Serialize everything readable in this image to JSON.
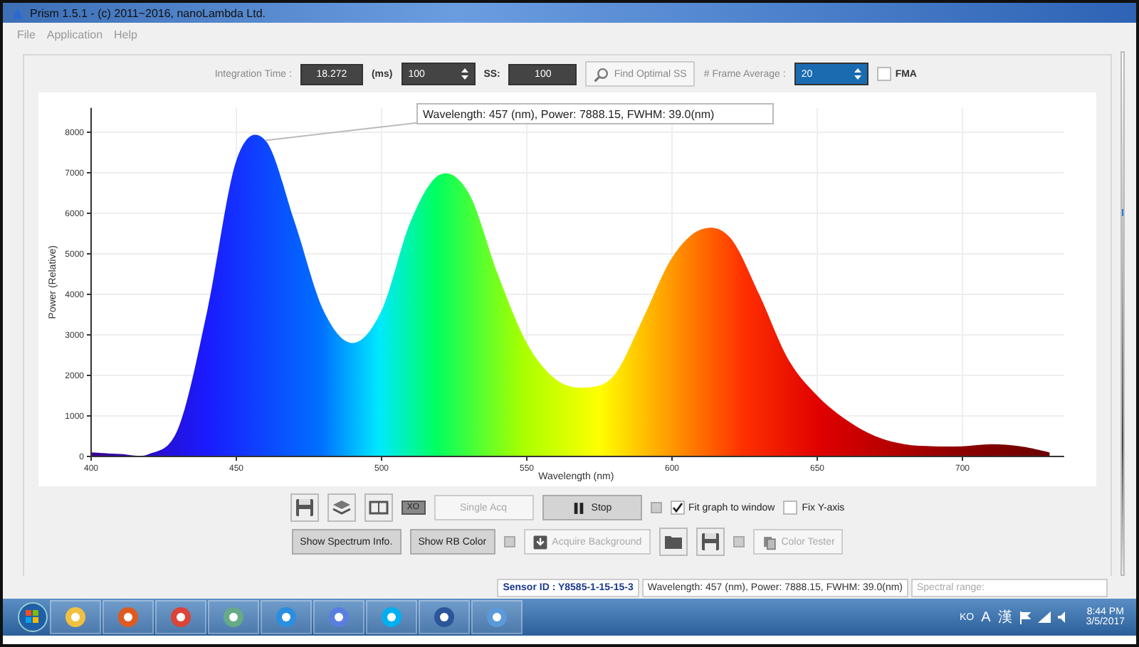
{
  "window": {
    "title": "Prism 1.5.1 - (c) 2011~2016, nanoLambda Ltd."
  },
  "menu": [
    "File",
    "Application",
    "Help"
  ],
  "acquisition": {
    "integration_label": "Integration Time :",
    "integration_value": "18.272",
    "unit": "(ms)",
    "unit_spin": "100",
    "ss_label": "SS:",
    "ss_value": "100",
    "find_button": "Find Optimal SS",
    "frame_label": "# Frame Average :",
    "frame_value": "20",
    "fma": {
      "label": "FMA",
      "checked": false
    }
  },
  "chart": {
    "peak_info": "Wavelength: 457 (nm), Power: 7888.15, FWHM: 39.0(nm)",
    "chart_data": {
      "type": "area",
      "xlabel": "Wavelength (nm)",
      "ylabel": "Power (Relative)",
      "x": [
        400,
        410,
        420,
        430,
        440,
        450,
        460,
        470,
        480,
        490,
        500,
        510,
        520,
        530,
        540,
        550,
        560,
        570,
        580,
        590,
        600,
        610,
        620,
        630,
        640,
        650,
        660,
        670,
        680,
        690,
        700,
        710,
        720,
        730
      ],
      "values": [
        100,
        60,
        60,
        700,
        3600,
        7300,
        7800,
        5800,
        3600,
        2800,
        3600,
        5800,
        6950,
        6500,
        4500,
        2800,
        1900,
        1700,
        2000,
        3400,
        4900,
        5600,
        5400,
        4000,
        2400,
        1500,
        900,
        500,
        300,
        250,
        250,
        300,
        250,
        100
      ],
      "grid": true,
      "xlim": [
        400,
        735
      ],
      "ylim": [
        0,
        8600
      ],
      "xticks": [
        400,
        450,
        500,
        550,
        600,
        650,
        700
      ],
      "yticks": [
        0,
        1000,
        2000,
        3000,
        4000,
        5000,
        6000,
        7000,
        8000
      ]
    }
  },
  "controls": [
    [
      {
        "kind": "icon_button"
      },
      {
        "kind": "icon_button"
      },
      {
        "kind": "icon_button"
      },
      {
        "kind": "tag",
        "label": "XO"
      },
      {
        "kind": "text_button",
        "label": "Single Acq",
        "pressed": false,
        "disabled": true
      },
      {
        "kind": "text_button",
        "label": "Stop",
        "pressed": true,
        "disabled": false
      },
      {
        "kind": "indicator"
      },
      {
        "kind": "checkbox",
        "label": "Fit graph to window",
        "checked": true
      },
      {
        "kind": "checkbox",
        "label": "Fix Y-axis",
        "checked": false
      }
    ],
    [
      {
        "kind": "text_button",
        "label": "Show Spectrum Info.",
        "pressed": true,
        "disabled": false
      },
      {
        "kind": "text_button",
        "label": "Show RB Color",
        "pressed": true,
        "disabled": false
      },
      {
        "kind": "indicator"
      },
      {
        "kind": "text_button",
        "label": "Acquire Background",
        "pressed": false,
        "disabled": true
      },
      {
        "kind": "icon_button"
      },
      {
        "kind": "icon_button"
      },
      {
        "kind": "indicator"
      },
      {
        "kind": "text_button",
        "label": "Color Tester",
        "pressed": false,
        "disabled": true
      }
    ]
  ],
  "status_bar": {
    "sensor": "Sensor ID : Y8585-1-15-15-3",
    "reading": "Wavelength: 457 (nm), Power: 7888.15, FWHM: 39.0(nm)",
    "range": "Spectral range:"
  },
  "taskbar": {
    "tray": [
      "KO",
      "A",
      "漢"
    ],
    "time": "8:44 PM",
    "date": "3/5/2017"
  }
}
